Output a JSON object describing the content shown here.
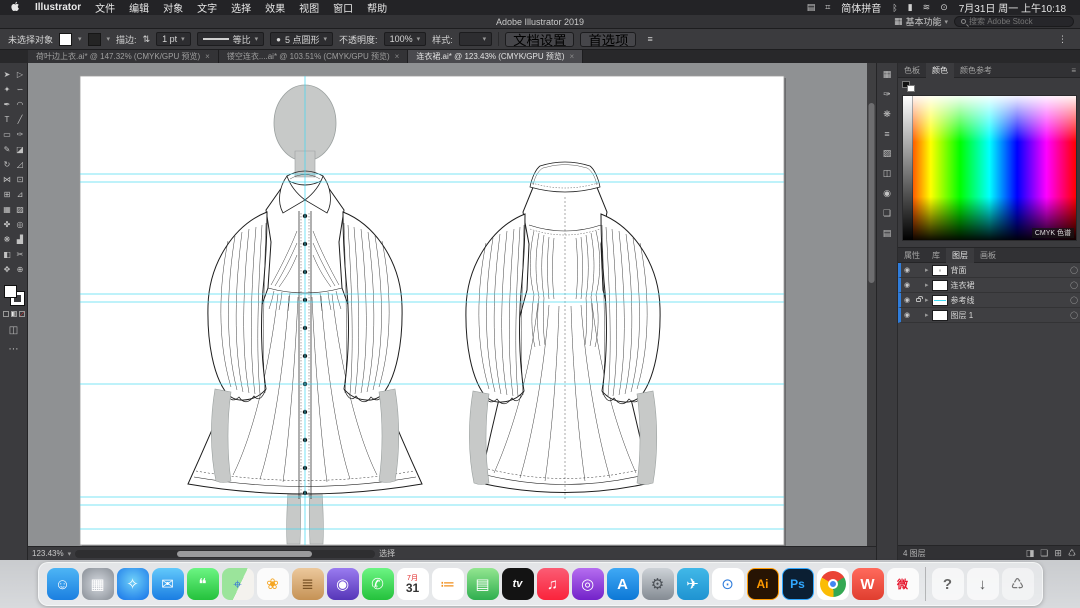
{
  "menubar": {
    "app_name": "Illustrator",
    "menus": [
      "文件",
      "编辑",
      "对象",
      "文字",
      "选择",
      "效果",
      "视图",
      "窗口",
      "帮助"
    ],
    "status": {
      "input_method": "简体拼音",
      "clock": "7月31日 周一 上午10:18"
    }
  },
  "titlebar": {
    "title": "Adobe Illustrator 2019",
    "workspace": "基本功能",
    "search_placeholder": "搜索 Adobe Stock"
  },
  "options": {
    "no_selection": "未选择对象",
    "stroke_label": "描边:",
    "stroke_value": "1 pt",
    "profile": "等比",
    "brush": "5 点圆形",
    "opacity_label": "不透明度:",
    "opacity_value": "100%",
    "style_label": "样式:",
    "document_setup": "文档设置",
    "preferences": "首选项"
  },
  "tabs": [
    {
      "label": "荷叶边上衣.ai* @ 147.32% (CMYK/GPU 预览)"
    },
    {
      "label": "镂空连衣....ai* @ 103.51% (CMYK/GPU 预览)"
    },
    {
      "label": "连衣裙.ai* @ 123.43% (CMYK/GPU 预览)"
    }
  ],
  "status_bar": {
    "zoom": "123.43%",
    "tool": "选择"
  },
  "right_panel": {
    "color_tabs": [
      "色板",
      "颜色",
      "颜色参考"
    ],
    "cmyk_label": "CMYK 色谱",
    "panel_tabs": [
      "属性",
      "库",
      "图层",
      "画板"
    ],
    "layers": [
      {
        "name": "背面"
      },
      {
        "name": "连衣裙"
      },
      {
        "name": "参考线"
      },
      {
        "name": "图层 1"
      }
    ],
    "layers_count": "4 图层"
  },
  "tools": [
    {
      "name": "selection",
      "glyph": "➤"
    },
    {
      "name": "direct-selection",
      "glyph": "▷"
    },
    {
      "name": "magic-wand",
      "glyph": "✦"
    },
    {
      "name": "lasso",
      "glyph": "∽"
    },
    {
      "name": "pen",
      "glyph": "✒"
    },
    {
      "name": "curvature",
      "glyph": "◠"
    },
    {
      "name": "type",
      "glyph": "T"
    },
    {
      "name": "line-segment",
      "glyph": "╱"
    },
    {
      "name": "rectangle",
      "glyph": "▭"
    },
    {
      "name": "paintbrush",
      "glyph": "✑"
    },
    {
      "name": "pencil",
      "glyph": "✎"
    },
    {
      "name": "eraser",
      "glyph": "◪"
    },
    {
      "name": "rotate",
      "glyph": "↻"
    },
    {
      "name": "scale",
      "glyph": "◿"
    },
    {
      "name": "width",
      "glyph": "⋈"
    },
    {
      "name": "free-transform",
      "glyph": "⊡"
    },
    {
      "name": "shape-builder",
      "glyph": "⊞"
    },
    {
      "name": "perspective-grid",
      "glyph": "⊿"
    },
    {
      "name": "mesh",
      "glyph": "▦"
    },
    {
      "name": "gradient",
      "glyph": "▨"
    },
    {
      "name": "eyedropper",
      "glyph": "✤"
    },
    {
      "name": "blend",
      "glyph": "◎"
    },
    {
      "name": "symbol-sprayer",
      "glyph": "❋"
    },
    {
      "name": "column-graph",
      "glyph": "▟"
    },
    {
      "name": "artboard",
      "glyph": "◧"
    },
    {
      "name": "slice",
      "glyph": "✂"
    },
    {
      "name": "hand",
      "glyph": "✥"
    },
    {
      "name": "zoom",
      "glyph": "⊕"
    }
  ],
  "panel_strip_icons": [
    {
      "name": "swatches",
      "glyph": "▦"
    },
    {
      "name": "brushes",
      "glyph": "✑"
    },
    {
      "name": "symbols",
      "glyph": "❋"
    },
    {
      "name": "stroke",
      "glyph": "≡"
    },
    {
      "name": "gradient",
      "glyph": "▨"
    },
    {
      "name": "transparency",
      "glyph": "◫"
    },
    {
      "name": "appearance",
      "glyph": "◉"
    },
    {
      "name": "graphic-styles",
      "glyph": "❏"
    },
    {
      "name": "align",
      "glyph": "▤"
    }
  ],
  "dock": {
    "calendar_month": "7月",
    "calendar_day": "31",
    "items": [
      {
        "name": "finder",
        "glyph": "☺"
      },
      {
        "name": "launchpad",
        "glyph": "▦"
      },
      {
        "name": "safari",
        "glyph": "✧"
      },
      {
        "name": "mail",
        "glyph": "✉"
      },
      {
        "name": "messages",
        "glyph": "❝"
      },
      {
        "name": "maps",
        "glyph": "⌖"
      },
      {
        "name": "photos",
        "glyph": "❀"
      },
      {
        "name": "notes",
        "glyph": "≣"
      },
      {
        "name": "photo-booth",
        "glyph": "◉"
      },
      {
        "name": "facetime",
        "glyph": "✆"
      },
      {
        "name": "calendar",
        "glyph": ""
      },
      {
        "name": "reminders",
        "glyph": "≔"
      },
      {
        "name": "numbers",
        "glyph": "▤"
      },
      {
        "name": "apple-tv",
        "glyph": "tv"
      },
      {
        "name": "music",
        "glyph": "♫"
      },
      {
        "name": "podcasts",
        "glyph": "◎"
      },
      {
        "name": "app-store",
        "glyph": "A"
      },
      {
        "name": "system-preferences",
        "glyph": "⚙"
      },
      {
        "name": "telegram",
        "glyph": "✈"
      },
      {
        "name": "conference-app",
        "glyph": "⊙"
      },
      {
        "name": "illustrator",
        "glyph": "Ai"
      },
      {
        "name": "photoshop",
        "glyph": "Ps"
      },
      {
        "name": "chrome",
        "glyph": ""
      },
      {
        "name": "wps",
        "glyph": "W"
      },
      {
        "name": "weibo",
        "glyph": "微"
      },
      {
        "name": "help",
        "glyph": "?"
      },
      {
        "name": "downloads",
        "glyph": "↓"
      },
      {
        "name": "trash",
        "glyph": "♺"
      }
    ]
  },
  "colors": {
    "guide_cyan": "#3fd8f2",
    "pasteboard_gray": "#8f9193",
    "artboard_white": "#ffffff",
    "mannequin_gray": "#c7c9c8",
    "accent_blue": "#2f7ddc",
    "ai_brand_orange": "#ff9a00",
    "ps_brand_blue": "#31a8ff"
  }
}
